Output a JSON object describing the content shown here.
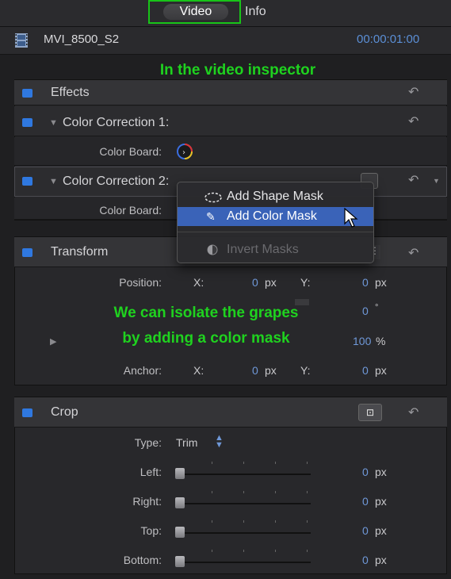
{
  "tabs": {
    "video": "Video",
    "info": "Info"
  },
  "clip": {
    "name": "MVI_8500_S2",
    "timecode": "00:00:01:00"
  },
  "annotations": {
    "top": "In the video inspector",
    "middle_line1": "We can isolate the grapes",
    "middle_line2": "by adding a color mask"
  },
  "effects": {
    "title": "Effects",
    "cc1": {
      "title": "Color Correction 1:",
      "board_label": "Color Board:"
    },
    "cc2": {
      "title": "Color Correction 2:",
      "board_label": "Color Board:"
    }
  },
  "menu": {
    "add_shape_mask": "Add Shape Mask",
    "add_color_mask": "Add Color Mask",
    "invert_masks": "Invert Masks"
  },
  "transform": {
    "title": "Transform",
    "position": {
      "label": "Position:",
      "x_label": "X:",
      "x_value": "0",
      "x_unit": "px",
      "y_label": "Y:",
      "y_value": "0",
      "y_unit": "px"
    },
    "rotation": {
      "value": "0",
      "unit": "°"
    },
    "scale": {
      "value": "100",
      "unit": "%"
    },
    "anchor": {
      "label": "Anchor:",
      "x_label": "X:",
      "x_value": "0",
      "x_unit": "px",
      "y_label": "Y:",
      "y_value": "0",
      "y_unit": "px"
    }
  },
  "crop": {
    "title": "Crop",
    "type": {
      "label": "Type:",
      "value": "Trim"
    },
    "rows": [
      {
        "label": "Left:",
        "value": "0",
        "unit": "px"
      },
      {
        "label": "Right:",
        "value": "0",
        "unit": "px"
      },
      {
        "label": "Top:",
        "value": "0",
        "unit": "px"
      },
      {
        "label": "Bottom:",
        "value": "0",
        "unit": "px"
      }
    ]
  },
  "colors": {
    "accent": "#2f78e0",
    "annotation": "#1fd21f",
    "menu_highlight": "#3a63b8",
    "timecode": "#5b8fd6"
  }
}
